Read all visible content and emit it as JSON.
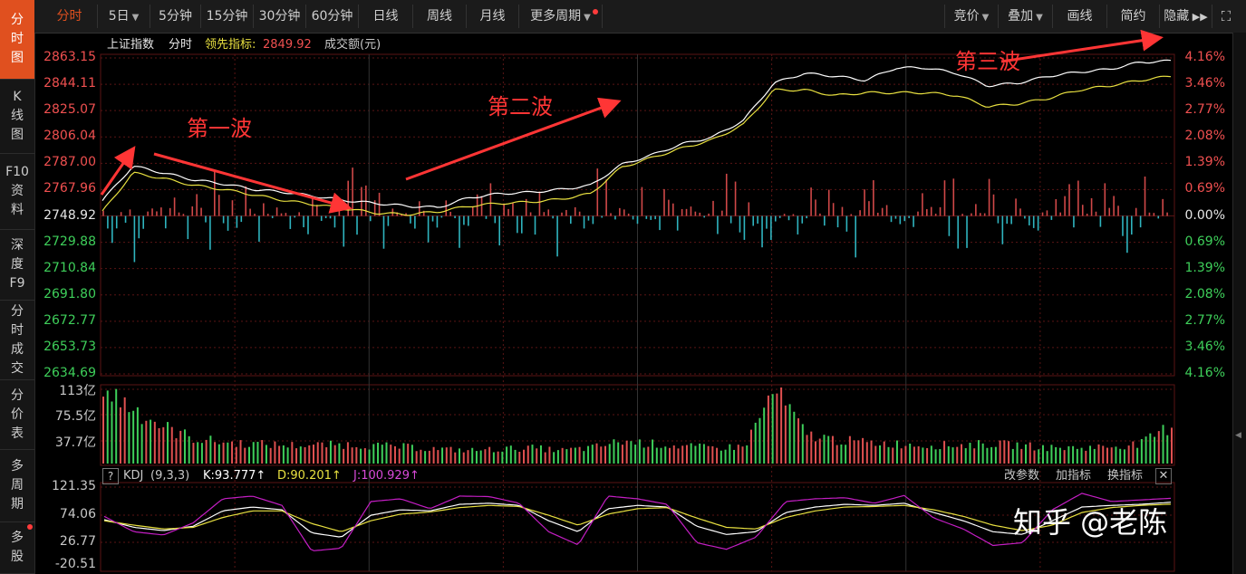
{
  "sidebar": {
    "items": [
      {
        "chars": [
          "分",
          "时",
          "图"
        ],
        "active": true
      },
      {
        "chars": [
          "K",
          "线",
          "图"
        ],
        "active": false
      },
      {
        "chars": [
          "F10",
          "资",
          "料"
        ],
        "active": false
      },
      {
        "chars": [
          "深",
          "度",
          "F9"
        ],
        "active": false
      },
      {
        "chars": [
          "分",
          "时",
          "成",
          "交"
        ],
        "active": false
      },
      {
        "chars": [
          "分",
          "价",
          "表"
        ],
        "active": false
      },
      {
        "chars": [
          "多",
          "周",
          "期"
        ],
        "active": false
      },
      {
        "chars": [
          "多",
          "股"
        ],
        "active": false
      }
    ]
  },
  "toolbar": {
    "periods": [
      "分时",
      "5日",
      "5分钟",
      "15分钟",
      "30分钟",
      "60分钟",
      "日线",
      "周线",
      "月线",
      "更多周期"
    ],
    "right": [
      "竞价",
      "叠加",
      "画线",
      "简约",
      "隐藏"
    ]
  },
  "legend": {
    "index": "上证指数",
    "mode": "分时",
    "leading_label": "领先指标:",
    "leading_value": "2849.92",
    "volume_label": "成交额(元)"
  },
  "price_axis": {
    "left": [
      "2863.15",
      "2844.11",
      "2825.07",
      "2806.04",
      "2787.00",
      "2767.96",
      "2748.92",
      "2729.88",
      "2710.84",
      "2691.80",
      "2672.77",
      "2653.73",
      "2634.69"
    ],
    "right": [
      "4.16%",
      "3.46%",
      "2.77%",
      "2.08%",
      "1.39%",
      "0.69%",
      "0.00%",
      "0.69%",
      "1.39%",
      "2.08%",
      "2.77%",
      "3.46%",
      "4.16%"
    ]
  },
  "volume_axis": [
    "113亿",
    "75.5亿",
    "37.7亿"
  ],
  "kdj": {
    "help": "?",
    "name": "KDJ",
    "params": "(9,3,3)",
    "k": "K:93.777↑",
    "d": "D:90.201↑",
    "j": "J:100.929↑",
    "axis": [
      "121.35",
      "74.06",
      "26.77",
      "-20.51"
    ],
    "buttons": [
      "改参数",
      "加指标",
      "换指标"
    ]
  },
  "annotations": [
    "第一波",
    "第二波",
    "第三波"
  ],
  "watermark": "知乎 @老陈",
  "colors": {
    "accent": "#e0501f",
    "up": "#f05050",
    "down": "#2fb4bf",
    "price": "#ffffff",
    "avg": "#e8e040",
    "k": "#ffffff",
    "d": "#e8e040",
    "j": "#c41ec4",
    "annotation": "#ff3535",
    "grid": "#5a1414"
  },
  "chart_data": {
    "type": "line",
    "title": "上证指数 分时",
    "ylim": [
      2634.69,
      2863.15
    ],
    "base": 2748.92,
    "price_series": [
      {
        "name": "上证指数",
        "values": [
          2760,
          2785,
          2780,
          2775,
          2772,
          2768,
          2766,
          2763,
          2760,
          2758,
          2756,
          2755,
          2762,
          2765,
          2766,
          2768,
          2771,
          2786,
          2793,
          2801,
          2806,
          2818,
          2845,
          2852,
          2850,
          2847,
          2856,
          2856,
          2852,
          2843,
          2845,
          2850,
          2853,
          2855,
          2860,
          2861
        ]
      },
      {
        "name": "领先指标",
        "values": [
          2752,
          2780,
          2776,
          2771,
          2768,
          2764,
          2760,
          2757,
          2754,
          2751,
          2750,
          2752,
          2756,
          2758,
          2759,
          2761,
          2765,
          2784,
          2791,
          2798,
          2804,
          2815,
          2840,
          2840,
          2836,
          2838,
          2838,
          2838,
          2836,
          2828,
          2830,
          2834,
          2840,
          2843,
          2847,
          2850
        ]
      }
    ],
    "volume_yi": [
      113,
      85,
      55,
      38,
      32,
      30,
      28,
      28,
      29,
      27,
      25,
      22,
      20,
      22,
      24,
      20,
      24,
      34,
      30,
      26,
      24,
      26,
      113,
      45,
      36,
      32,
      30,
      28,
      28,
      30,
      28,
      24,
      24,
      26,
      30,
      58
    ],
    "kdj_series": [
      {
        "name": "K",
        "values": [
          62,
          48,
          42,
          50,
          78,
          85,
          80,
          38,
          30,
          70,
          80,
          78,
          90,
          92,
          88,
          60,
          40,
          82,
          88,
          85,
          50,
          35,
          40,
          75,
          85,
          90,
          88,
          92,
          75,
          60,
          40,
          35,
          60,
          85,
          88,
          90,
          93.777
        ]
      },
      {
        "name": "D",
        "values": [
          60,
          52,
          45,
          48,
          66,
          78,
          78,
          55,
          40,
          60,
          72,
          76,
          84,
          88,
          86,
          70,
          52,
          72,
          82,
          84,
          65,
          48,
          45,
          66,
          78,
          85,
          86,
          88,
          80,
          68,
          52,
          42,
          52,
          75,
          84,
          88,
          90.201
        ]
      },
      {
        "name": "J",
        "values": [
          68,
          40,
          34,
          56,
          100,
          105,
          88,
          5,
          10,
          95,
          100,
          82,
          105,
          104,
          92,
          40,
          16,
          105,
          100,
          90,
          20,
          8,
          30,
          95,
          100,
          102,
          92,
          106,
          65,
          45,
          15,
          20,
          80,
          110,
          95,
          98,
          100.929
        ]
      }
    ],
    "kdj_ylim": [
      -20.51,
      121.35
    ]
  }
}
